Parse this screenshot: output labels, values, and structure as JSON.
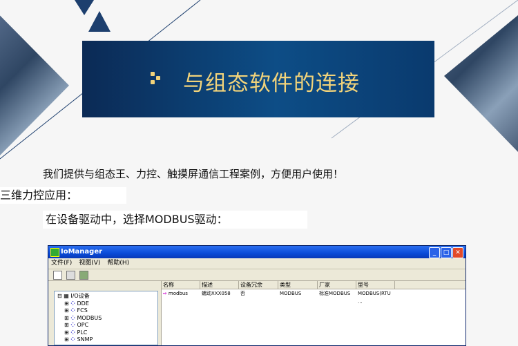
{
  "banner": {
    "title": "与组态软件的连接"
  },
  "intro": "我们提供与组态王、力控、触摸屏通信工程案例，方便用户使用！",
  "section_heading": "三维力控应用：",
  "instruction": "在设备驱动中，选择MODBUS驱动：",
  "window": {
    "title": "IoManager",
    "menu": [
      "文件(F)",
      "视图(V)",
      "帮助(H)"
    ],
    "tree_root": "I/O设备",
    "tree_items": [
      "DDE",
      "FCS",
      "MODBUS",
      "OPC",
      "PLC",
      "SNMP"
    ],
    "columns": [
      "名称",
      "描述",
      "设备冗余",
      "类型",
      "厂家",
      "型号"
    ],
    "rows": [
      {
        "name": "modbus",
        "desc": "蠕动XXX058",
        "redundant": "否",
        "type": "MODBUS",
        "vendor": "标准MODBUS",
        "model": "MODBUS(RTU ..."
      }
    ]
  }
}
